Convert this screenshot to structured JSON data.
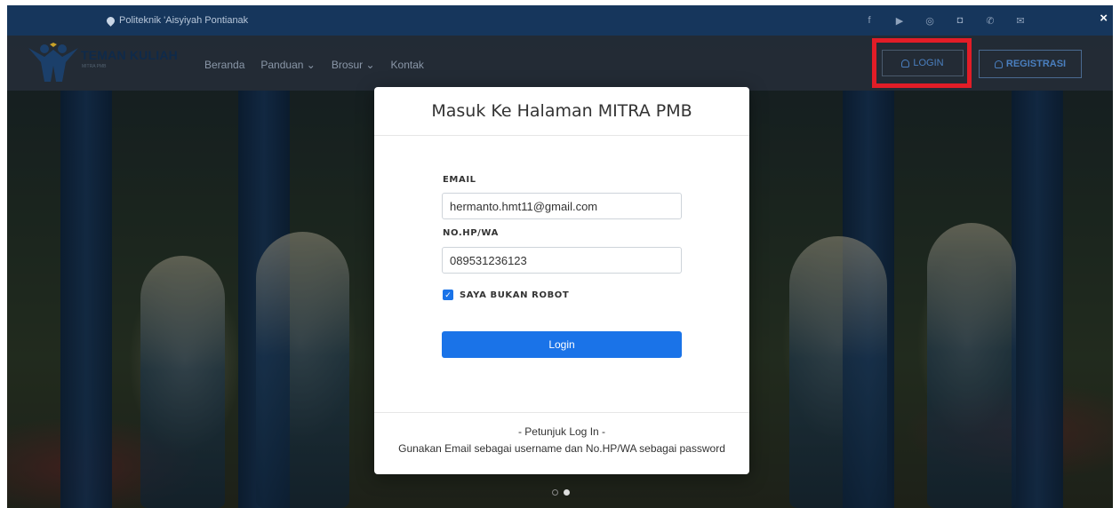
{
  "topbar": {
    "location": "Politeknik 'Aisyiyah Pontianak",
    "socials": [
      "f",
      "▶",
      "◎",
      "◘",
      "✆",
      "✉"
    ],
    "close": "×"
  },
  "navbar": {
    "brand": "TEMAN KULIAH",
    "brand_sub": "MITRA PMB",
    "menu": [
      "Beranda",
      "Panduan ⌄",
      "Brosur ⌄",
      "Kontak"
    ],
    "login_label": "LOGIN",
    "register_label": "REGISTRASI"
  },
  "modal": {
    "title": "Masuk Ke Halaman MITRA PMB",
    "email_label": "EMAIL",
    "email_value": "hermanto.hmt11@gmail.com",
    "phone_label": "NO.HP/WA",
    "phone_value": "089531236123",
    "robot_label": "SAYA BUKAN ROBOT",
    "robot_checked": true,
    "submit_label": "Login",
    "footer_title": "- Petunjuk Log In -",
    "footer_text": "Gunakan Email sebagai username dan No.HP/WA sebagai password"
  },
  "colors": {
    "accent": "#1a73e8",
    "topbar": "#16365c",
    "highlight": "#e21d27"
  }
}
